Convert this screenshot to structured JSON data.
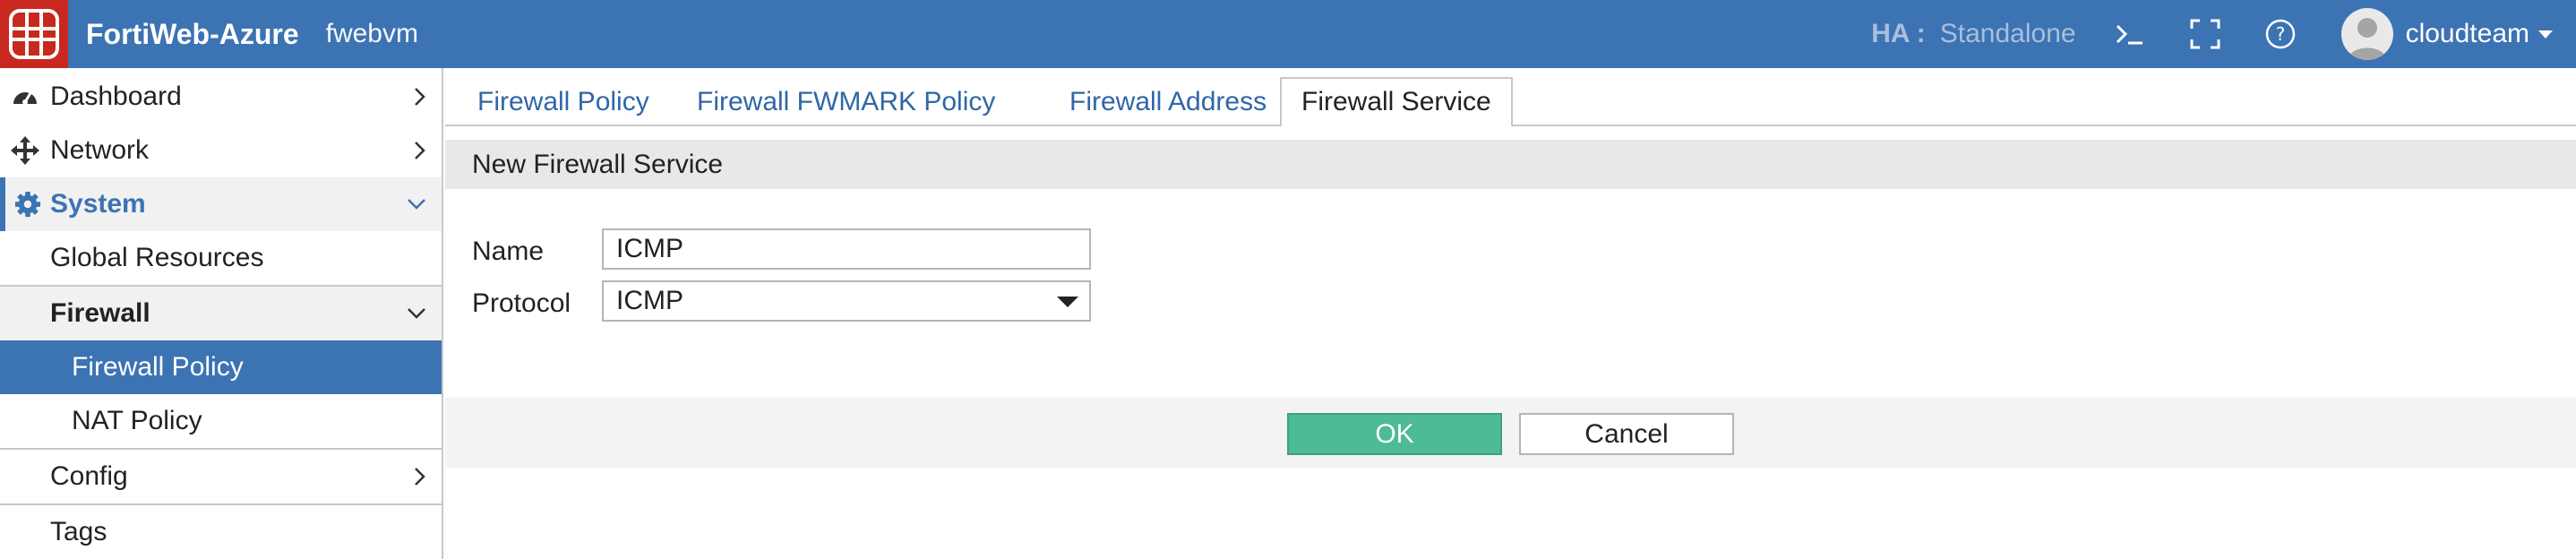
{
  "header": {
    "product": "FortiWeb-Azure",
    "hostname": "fwebvm",
    "ha_label": "HA :",
    "ha_value": "Standalone",
    "icons": [
      "fortinet-logo-icon",
      "cli-console-icon",
      "fullscreen-icon",
      "help-icon",
      "user-avatar-icon"
    ],
    "username": "cloudteam",
    "brand_color": "#3c73b3",
    "logo_color": "#c8281e"
  },
  "sidebar": {
    "items": [
      {
        "label": "Dashboard",
        "icon": "dashboard-icon"
      },
      {
        "label": "Network",
        "icon": "network-icon"
      },
      {
        "label": "System",
        "icon": "gear-icon"
      },
      {
        "label": "Global Resources"
      },
      {
        "label": "Firewall"
      },
      {
        "label": "Firewall Policy"
      },
      {
        "label": "NAT Policy"
      },
      {
        "label": "Config"
      },
      {
        "label": "Tags"
      }
    ]
  },
  "main": {
    "tabs": [
      {
        "label": "Firewall Policy"
      },
      {
        "label": "Firewall FWMARK Policy"
      },
      {
        "label": "Firewall Address"
      },
      {
        "label": "Firewall Service",
        "active": true
      }
    ],
    "section_title": "New Firewall Service",
    "form": {
      "name_label": "Name",
      "name_value": "ICMP",
      "protocol_label": "Protocol",
      "protocol_value": "ICMP"
    },
    "buttons": {
      "ok": "OK",
      "cancel": "Cancel"
    },
    "ok_color": "#4dbb93"
  }
}
